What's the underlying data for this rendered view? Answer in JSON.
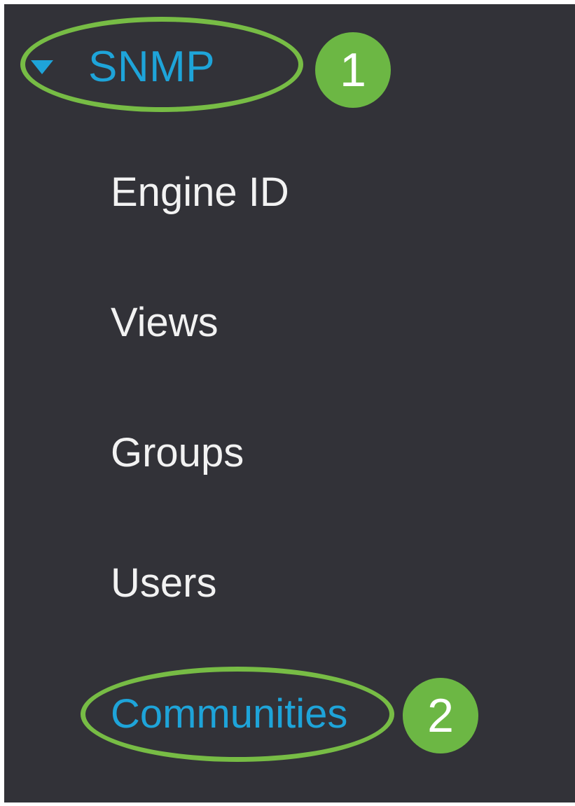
{
  "colors": {
    "panel_background": "#323238",
    "accent_blue": "#1ea4d9",
    "item_text": "#f2f2f2",
    "annotation_green": "#77bc45",
    "badge_green": "#6cb744"
  },
  "nav": {
    "section": {
      "label": "SNMP",
      "expanded": true,
      "icon": "caret-down-icon"
    },
    "items": [
      {
        "label": "Engine ID",
        "active": false
      },
      {
        "label": "Views",
        "active": false
      },
      {
        "label": "Groups",
        "active": false
      },
      {
        "label": "Users",
        "active": false
      },
      {
        "label": "Communities",
        "active": true
      }
    ]
  },
  "annotations": {
    "step_1": "1",
    "step_2": "2"
  }
}
